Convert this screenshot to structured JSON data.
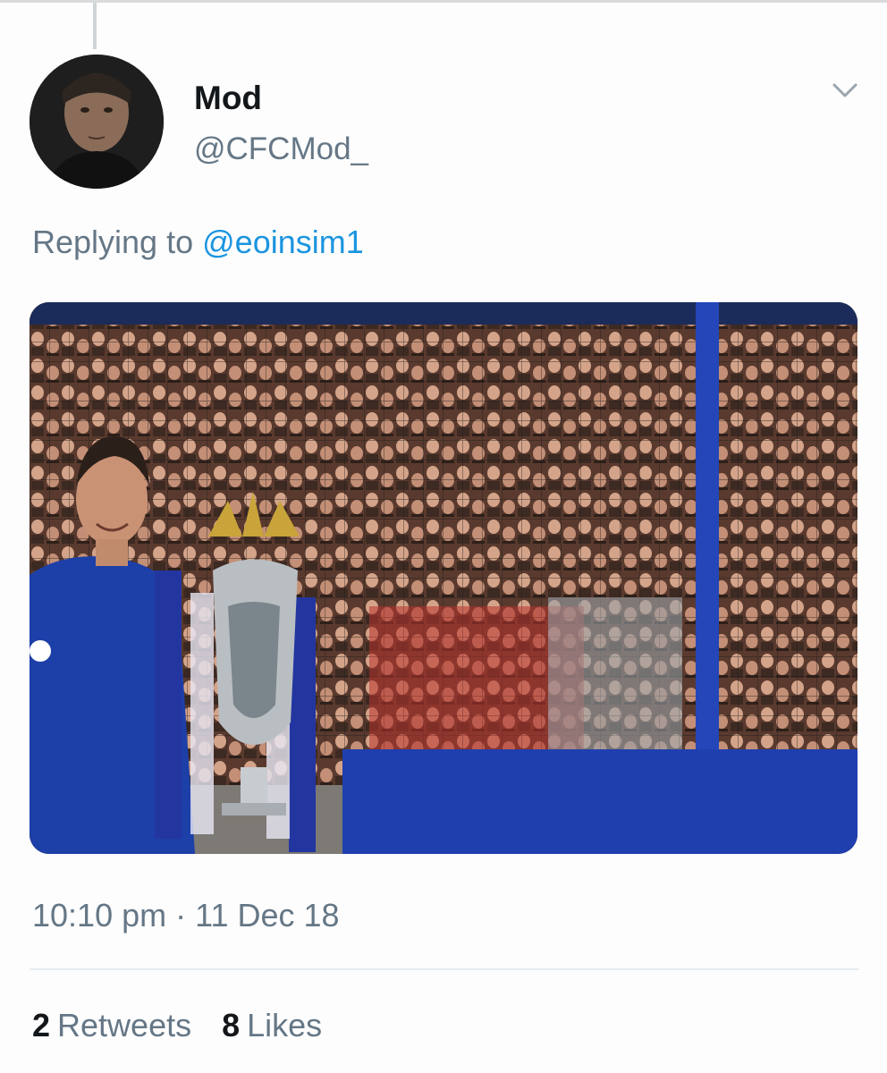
{
  "tweet": {
    "author_name": "Mod",
    "author_handle": "@CFCMod_",
    "replying_prefix": "Replying to",
    "replying_to": "@eoinsim1",
    "timestamp": "10:10 pm · 11 Dec 18",
    "retweets_count": "2",
    "retweets_label": "Retweets",
    "likes_count": "8",
    "likes_label": "Likes"
  },
  "icons": {
    "menu": "chevron-down-icon"
  },
  "colors": {
    "link": "#1b95e0",
    "secondary_text": "#657786",
    "primary_text": "#14171a",
    "kit_blue": "#1d3fa8"
  }
}
